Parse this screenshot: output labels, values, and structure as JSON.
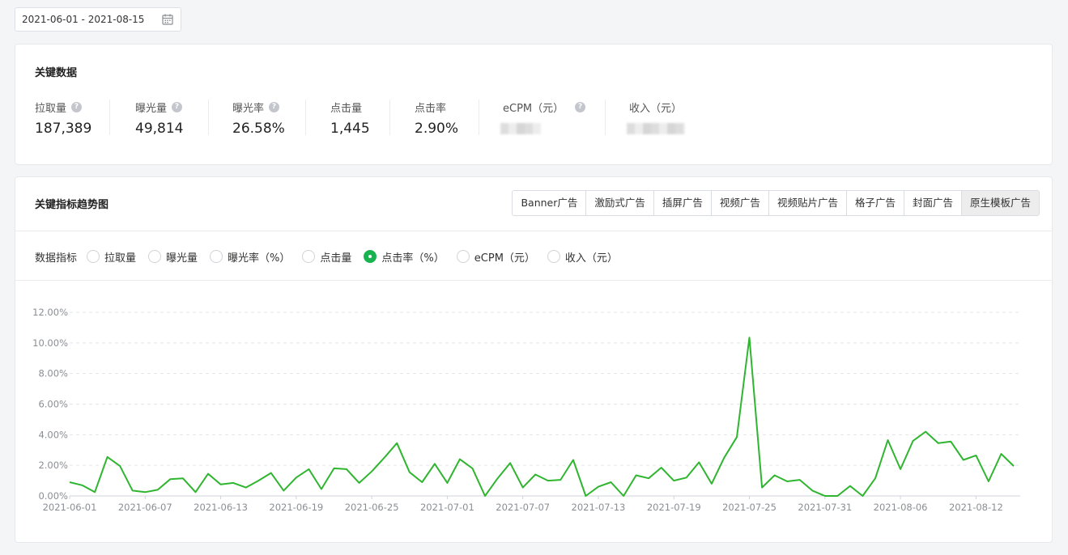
{
  "date_range": "2021-06-01 - 2021-08-15",
  "kpi_card": {
    "title": "关键数据",
    "items": [
      {
        "label": "拉取量",
        "value": "187,389",
        "help": true
      },
      {
        "label": "曝光量",
        "value": "49,814",
        "help": true
      },
      {
        "label": "曝光率",
        "value": "26.58%",
        "help": true
      },
      {
        "label": "点击量",
        "value": "1,445",
        "help": false
      },
      {
        "label": "点击率",
        "value": "2.90%",
        "help": false
      },
      {
        "label": "eCPM（元）",
        "value": null,
        "help": true,
        "obscured": true
      },
      {
        "label": "收入（元）",
        "value": null,
        "help": false,
        "obscured": true
      }
    ]
  },
  "trend_card": {
    "title": "关键指标趋势图",
    "tabs": [
      "Banner广告",
      "激励式广告",
      "插屏广告",
      "视频广告",
      "视频贴片广告",
      "格子广告",
      "封面广告",
      "原生模板广告"
    ],
    "active_tab": "原生模板广告",
    "metrics_label": "数据指标",
    "metrics": [
      "拉取量",
      "曝光量",
      "曝光率（%）",
      "点击量",
      "点击率（%）",
      "eCPM（元）",
      "收入（元）"
    ],
    "selected_metric": "点击率（%）"
  },
  "colors": {
    "line": "#2fb52f",
    "accent": "#18b34f"
  },
  "icons": {
    "calendar": "calendar-icon",
    "help": "question-circle-icon"
  },
  "chart_data": {
    "type": "line",
    "x": [
      "2021-06-01",
      "2021-06-02",
      "2021-06-03",
      "2021-06-04",
      "2021-06-05",
      "2021-06-06",
      "2021-06-07",
      "2021-06-08",
      "2021-06-09",
      "2021-06-10",
      "2021-06-11",
      "2021-06-12",
      "2021-06-13",
      "2021-06-14",
      "2021-06-15",
      "2021-06-16",
      "2021-06-17",
      "2021-06-18",
      "2021-06-19",
      "2021-06-20",
      "2021-06-21",
      "2021-06-22",
      "2021-06-23",
      "2021-06-24",
      "2021-06-25",
      "2021-06-26",
      "2021-06-27",
      "2021-06-28",
      "2021-06-29",
      "2021-06-30",
      "2021-07-01",
      "2021-07-02",
      "2021-07-03",
      "2021-07-04",
      "2021-07-05",
      "2021-07-06",
      "2021-07-07",
      "2021-07-08",
      "2021-07-09",
      "2021-07-10",
      "2021-07-11",
      "2021-07-12",
      "2021-07-13",
      "2021-07-14",
      "2021-07-15",
      "2021-07-16",
      "2021-07-17",
      "2021-07-18",
      "2021-07-19",
      "2021-07-20",
      "2021-07-21",
      "2021-07-22",
      "2021-07-23",
      "2021-07-24",
      "2021-07-25",
      "2021-07-26",
      "2021-07-27",
      "2021-07-28",
      "2021-07-29",
      "2021-07-30",
      "2021-07-31",
      "2021-08-01",
      "2021-08-02",
      "2021-08-03",
      "2021-08-04",
      "2021-08-05",
      "2021-08-06",
      "2021-08-07",
      "2021-08-08",
      "2021-08-09",
      "2021-08-10",
      "2021-08-11",
      "2021-08-12",
      "2021-08-13",
      "2021-08-14",
      "2021-08-15"
    ],
    "x_tick_labels": [
      "2021-06-01",
      "2021-06-07",
      "2021-06-13",
      "2021-06-19",
      "2021-06-25",
      "2021-07-01",
      "2021-07-07",
      "2021-07-13",
      "2021-07-19",
      "2021-07-25",
      "2021-07-31",
      "2021-08-06",
      "2021-08-12"
    ],
    "series": [
      {
        "values": [
          0.9,
          0.7,
          0.25,
          2.55,
          1.95,
          0.35,
          0.25,
          0.4,
          1.1,
          1.15,
          0.25,
          1.45,
          0.75,
          0.85,
          0.55,
          1.0,
          1.5,
          0.35,
          1.2,
          1.75,
          0.45,
          1.8,
          1.75,
          0.85,
          1.6,
          2.5,
          3.45,
          1.55,
          0.9,
          2.1,
          0.85,
          2.4,
          1.8,
          0.0,
          1.15,
          2.15,
          0.55,
          1.4,
          1.0,
          1.05,
          2.35,
          0.0,
          0.6,
          0.9,
          0.0,
          1.35,
          1.15,
          1.85,
          1.0,
          1.2,
          2.2,
          0.8,
          2.5,
          3.85,
          10.35,
          0.55,
          1.35,
          0.95,
          1.05,
          0.35,
          0.0,
          0.0,
          0.65,
          0.0,
          1.15,
          3.65,
          1.75,
          3.6,
          4.2,
          3.45,
          3.55,
          2.35,
          2.65,
          0.95,
          2.75,
          1.95
        ]
      }
    ],
    "y_tick_labels": [
      "0.00%",
      "2.00%",
      "4.00%",
      "6.00%",
      "8.00%",
      "10.00%",
      "12.00%"
    ],
    "ylim": [
      0,
      12
    ],
    "grid": true,
    "legend": "none"
  }
}
